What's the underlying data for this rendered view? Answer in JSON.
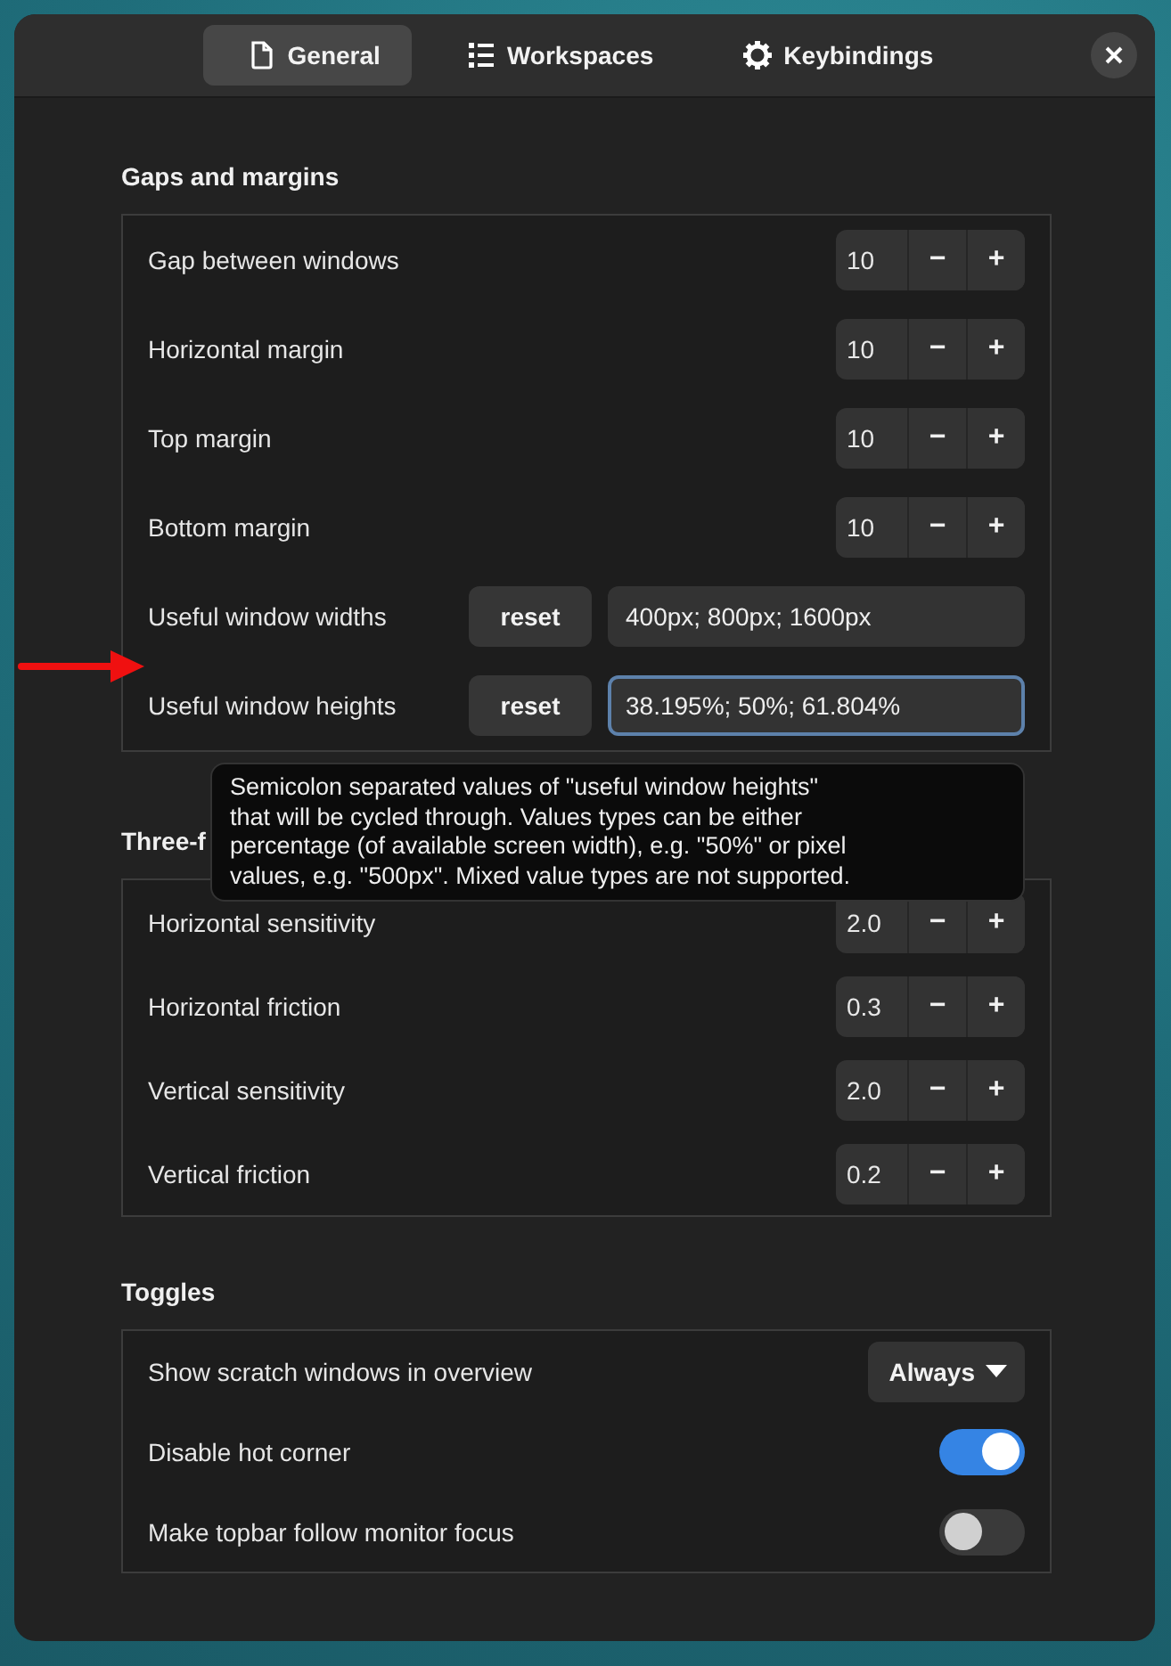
{
  "tabs": [
    {
      "label": "General",
      "selected": true
    },
    {
      "label": "Workspaces",
      "selected": false
    },
    {
      "label": "Keybindings",
      "selected": false
    }
  ],
  "sections": [
    {
      "title": "Gaps and margins",
      "rows": [
        {
          "kind": "spin",
          "label": "Gap between windows",
          "value": "10",
          "minus": "−",
          "plus": "+"
        },
        {
          "kind": "spin",
          "label": "Horizontal margin",
          "value": "10",
          "minus": "−",
          "plus": "+"
        },
        {
          "kind": "spin",
          "label": "Top margin",
          "value": "10",
          "minus": "−",
          "plus": "+"
        },
        {
          "kind": "spin",
          "label": "Bottom margin",
          "value": "10",
          "minus": "−",
          "plus": "+"
        },
        {
          "kind": "entry",
          "label": "Useful window widths",
          "button": "reset",
          "value": "400px; 800px; 1600px",
          "focused": false
        },
        {
          "kind": "entry",
          "label": "Useful window heights",
          "button": "reset",
          "value": "38.195%; 50%; 61.804%",
          "focused": true
        }
      ]
    },
    {
      "title": "Three-f",
      "rows": [
        {
          "kind": "spin",
          "label": "Horizontal sensitivity",
          "value": "2.0",
          "minus": "−",
          "plus": "+"
        },
        {
          "kind": "spin",
          "label": "Horizontal friction",
          "value": "0.3",
          "minus": "−",
          "plus": "+"
        },
        {
          "kind": "spin",
          "label": "Vertical sensitivity",
          "value": "2.0",
          "minus": "−",
          "plus": "+"
        },
        {
          "kind": "spin",
          "label": "Vertical friction",
          "value": "0.2",
          "minus": "−",
          "plus": "+"
        }
      ]
    },
    {
      "title": "Toggles",
      "rows": [
        {
          "kind": "dropdown",
          "label": "Show scratch windows in overview",
          "value": "Always"
        },
        {
          "kind": "switch",
          "label": "Disable hot corner",
          "on": true
        },
        {
          "kind": "switch",
          "label": "Make topbar follow monitor focus",
          "on": false
        }
      ]
    }
  ],
  "tooltip": {
    "text": "Semicolon separated values of \"useful window heights\"\nthat will be cycled through. Values types can be either\npercentage (of available screen width), e.g. \"50%\" or pixel\nvalues, e.g. \"500px\". Mixed value types are not supported."
  }
}
